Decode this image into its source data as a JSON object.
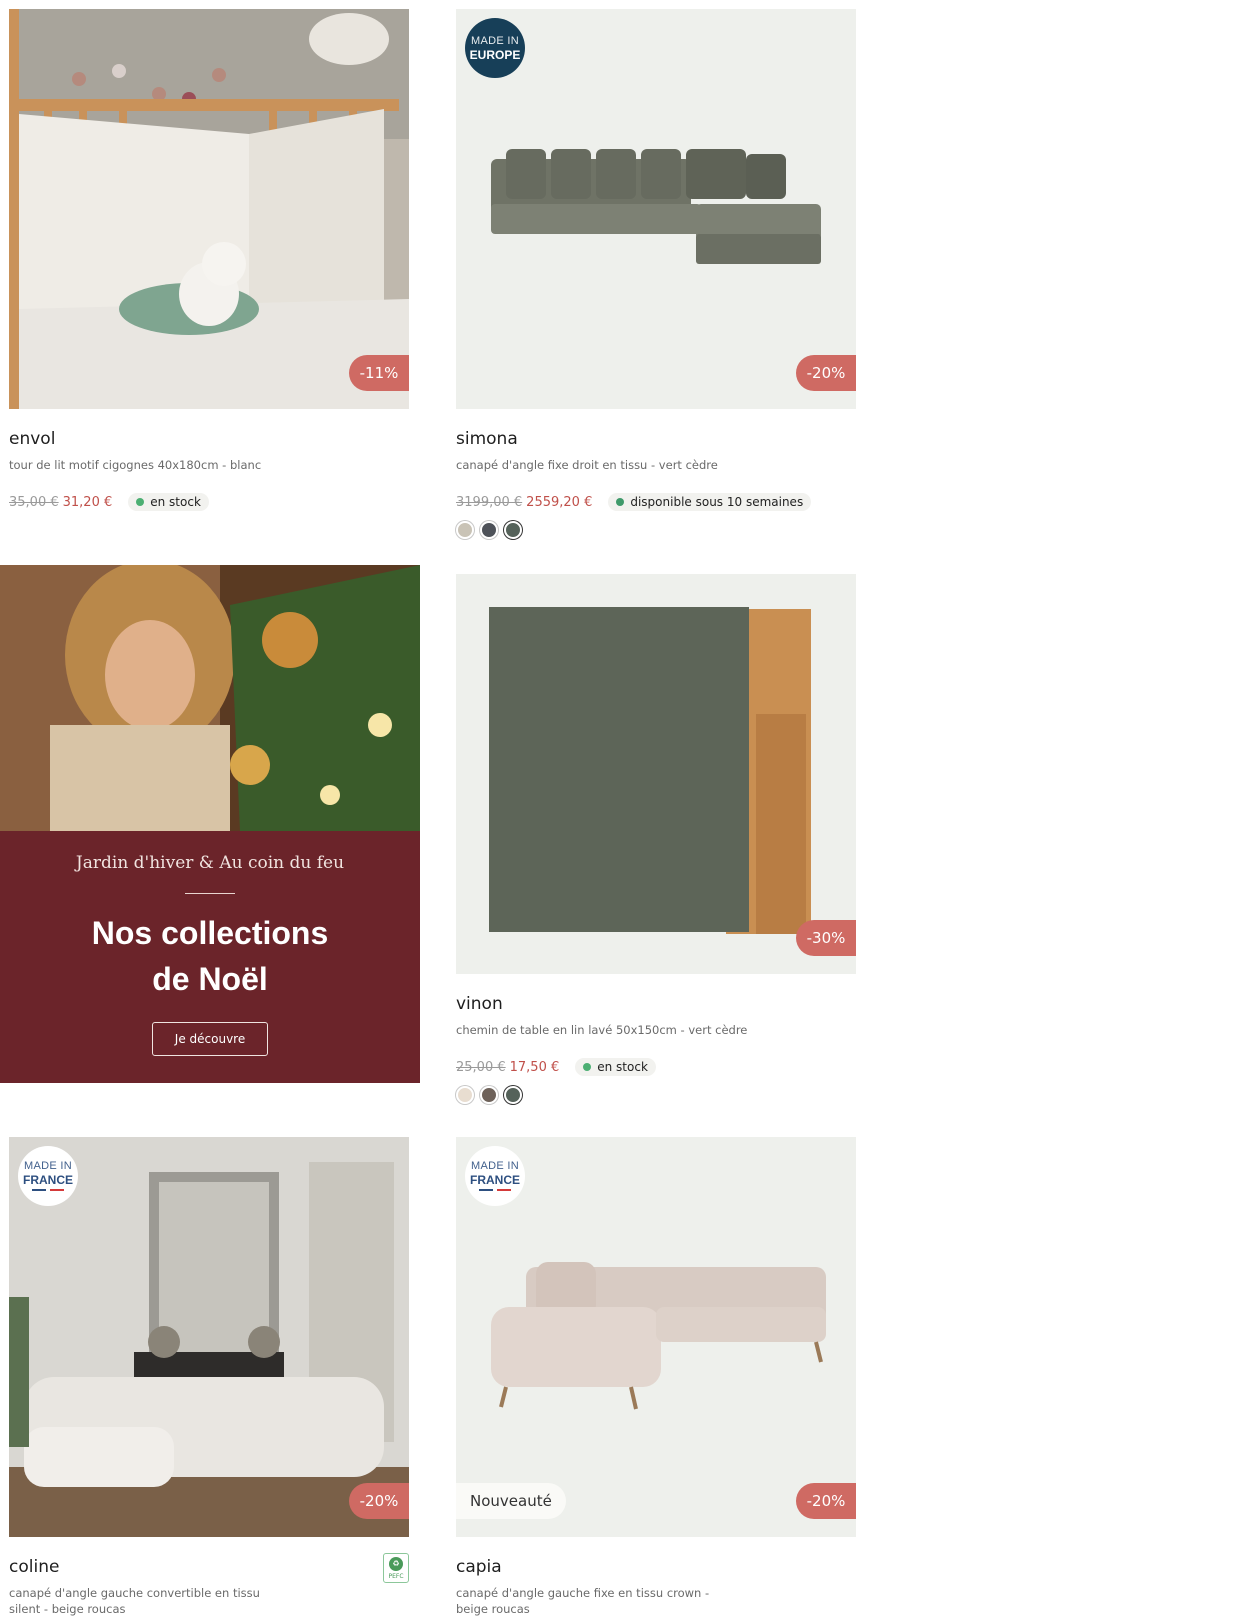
{
  "products": [
    {
      "name": "envol",
      "desc": "tour de lit motif cigognes 40x180cm - blanc",
      "price_old": "35,00 €",
      "price_new": "31,20 €",
      "stock": "en stock",
      "discount": "-11%"
    },
    {
      "name": "simona",
      "desc": "canapé d'angle fixe droit en tissu - vert cèdre",
      "price_old": "3199,00 €",
      "price_new": "2559,20 €",
      "stock": "disponible sous 10 semaines",
      "discount": "-20%",
      "origin_l1": "MADE IN",
      "origin_l2": "EUROPE",
      "swatches": [
        "#c9c3b6",
        "#4e5259",
        "#55625a"
      ]
    },
    {
      "name": "vinon",
      "desc": "chemin de table en lin lavé 50x150cm - vert cèdre",
      "price_old": "25,00 €",
      "price_new": "17,50 €",
      "stock": "en stock",
      "discount": "-30%",
      "swatches": [
        "#e8ddd0",
        "#6e625a",
        "#55625a"
      ]
    },
    {
      "name": "coline",
      "desc": "canapé d'angle gauche convertible en tissu silent - beige roucas",
      "discount": "-20%",
      "origin_l1": "MADE IN",
      "origin_l2": "FRANCE",
      "label": "PEFC"
    },
    {
      "name": "capia",
      "desc": "canapé d'angle gauche fixe en tissu crown - beige roucas",
      "discount": "-20%",
      "origin_l1": "MADE IN",
      "origin_l2": "FRANCE",
      "tag": "Nouveauté"
    }
  ],
  "promo": {
    "subtitle": "Jardin d'hiver & Au coin du feu",
    "title_line1": "Nos collections",
    "title_line2": "de Noël",
    "cta": "Je découvre"
  }
}
